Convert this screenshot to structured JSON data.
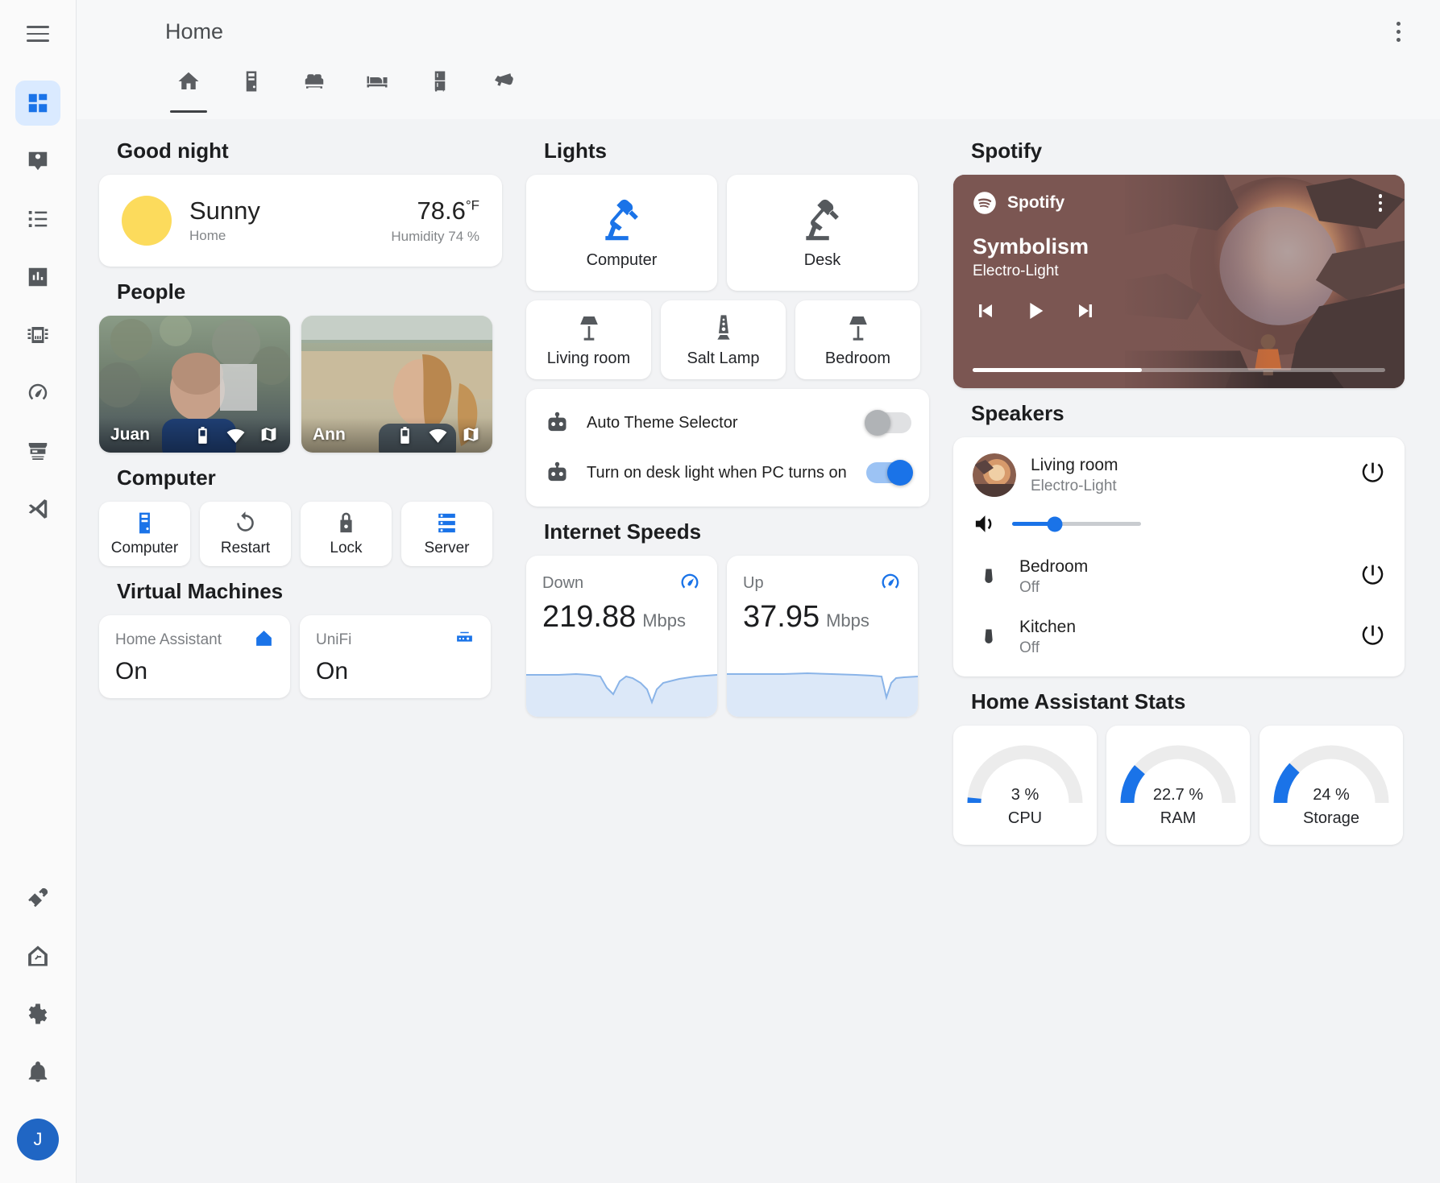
{
  "topbar": {
    "title": "Home",
    "menu_icon": "hamburger-icon",
    "overflow_icon": "dots-vertical-icon"
  },
  "sidebar": {
    "items": [
      {
        "name": "dashboard",
        "icon": "view-dashboard-icon",
        "active": true
      },
      {
        "name": "map-person",
        "icon": "map-marker-account-icon",
        "active": false
      },
      {
        "name": "logbook",
        "icon": "format-list-bulleted-icon",
        "active": false
      },
      {
        "name": "history",
        "icon": "chart-box-icon",
        "active": false
      },
      {
        "name": "hardware",
        "icon": "memory-chip-icon",
        "active": false
      },
      {
        "name": "speedtest",
        "icon": "gauge-icon",
        "active": false
      },
      {
        "name": "hacs",
        "icon": "hacs-store-icon",
        "active": false,
        "label": "HACS"
      },
      {
        "name": "vscode",
        "icon": "visual-studio-code-icon",
        "active": false
      }
    ],
    "bottom": [
      {
        "name": "developer-tools",
        "icon": "hammer-wrench-icon"
      },
      {
        "name": "supervisor",
        "icon": "home-assistant-icon"
      },
      {
        "name": "settings",
        "icon": "cog-icon"
      },
      {
        "name": "notifications",
        "icon": "bell-icon"
      }
    ],
    "avatar_initial": "J"
  },
  "tabs": [
    {
      "name": "home",
      "icon": "home-icon",
      "active": true
    },
    {
      "name": "computer",
      "icon": "desktop-tower-icon",
      "active": false
    },
    {
      "name": "living-room",
      "icon": "sofa-icon",
      "active": false
    },
    {
      "name": "bedroom",
      "icon": "bed-icon",
      "active": false
    },
    {
      "name": "kitchen",
      "icon": "fridge-icon",
      "active": false
    },
    {
      "name": "cameras",
      "icon": "cctv-icon",
      "active": false
    }
  ],
  "greeting": {
    "title": "Good night"
  },
  "weather": {
    "condition": "Sunny",
    "location": "Home",
    "temperature": "78.6",
    "temperature_unit": "°F",
    "humidity": "Humidity 74 %",
    "icon": "weather-sunny-icon",
    "icon_color": "#fcdb5c"
  },
  "people": {
    "title": "People",
    "items": [
      {
        "name": "Juan",
        "badges": [
          "battery-icon",
          "wifi-icon",
          "map-icon"
        ]
      },
      {
        "name": "Ann",
        "badges": [
          "battery-icon",
          "wifi-icon",
          "map-icon"
        ]
      }
    ]
  },
  "computer": {
    "title": "Computer",
    "buttons": [
      {
        "label": "Computer",
        "icon": "desktop-tower-icon",
        "state": "on"
      },
      {
        "label": "Restart",
        "icon": "restart-icon",
        "state": "off"
      },
      {
        "label": "Lock",
        "icon": "lock-icon",
        "state": "off"
      },
      {
        "label": "Server",
        "icon": "server-icon",
        "state": "on"
      }
    ]
  },
  "virtual_machines": {
    "title": "Virtual Machines",
    "items": [
      {
        "name": "Home Assistant",
        "state": "On",
        "icon": "home-assistant-icon"
      },
      {
        "name": "UniFi",
        "state": "On",
        "icon": "router-network-icon"
      }
    ]
  },
  "lights": {
    "title": "Lights",
    "big": [
      {
        "label": "Computer",
        "icon": "desk-lamp-icon",
        "state": "on"
      },
      {
        "label": "Desk",
        "icon": "desk-lamp-icon",
        "state": "off"
      }
    ],
    "small": [
      {
        "label": "Living room",
        "icon": "floor-lamp-icon",
        "state": "off"
      },
      {
        "label": "Salt Lamp",
        "icon": "lava-lamp-icon",
        "state": "off"
      },
      {
        "label": "Bedroom",
        "icon": "floor-lamp-icon",
        "state": "off"
      }
    ]
  },
  "automations": [
    {
      "label": "Auto Theme Selector",
      "icon": "robot-icon",
      "state": "off"
    },
    {
      "label": "Turn on desk light when PC turns on",
      "icon": "robot-icon",
      "state": "on"
    }
  ],
  "internet": {
    "title": "Internet Speeds",
    "items": [
      {
        "name": "Down",
        "value": "219.88",
        "unit": "Mbps",
        "icon": "speedometer-icon"
      },
      {
        "name": "Up",
        "value": "37.95",
        "unit": "Mbps",
        "icon": "speedometer-icon"
      }
    ]
  },
  "spotify": {
    "title": "Spotify",
    "source": "Spotify",
    "track": "Symbolism",
    "artist": "Electro-Light",
    "progress_percent": 41,
    "controls": [
      "previous-icon",
      "play-icon",
      "next-icon"
    ],
    "overflow_icon": "dots-vertical-icon",
    "background_color": "#7b5652"
  },
  "speakers": {
    "title": "Speakers",
    "active": {
      "name": "Living room",
      "sub": "Electro-Light",
      "volume_percent": 33,
      "icons": [
        "volume-high-icon",
        "previous-icon",
        "play-icon",
        "next-icon"
      ],
      "power_icon": "power-icon"
    },
    "others": [
      {
        "name": "Bedroom",
        "state": "Off",
        "icon": "speaker-icon",
        "power_icon": "power-icon"
      },
      {
        "name": "Kitchen",
        "state": "Off",
        "icon": "speaker-icon",
        "power_icon": "power-icon"
      }
    ]
  },
  "stats": {
    "title": "Home Assistant Stats",
    "gauges": [
      {
        "label": "CPU",
        "value": "3 %",
        "percent": 3
      },
      {
        "label": "RAM",
        "value": "22.7 %",
        "percent": 22.7
      },
      {
        "label": "Storage",
        "value": "24 %",
        "percent": 24
      }
    ],
    "accent": "#1a73e8"
  }
}
